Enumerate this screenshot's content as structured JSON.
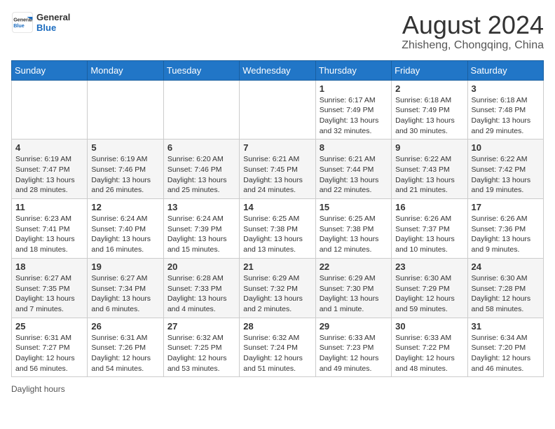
{
  "header": {
    "logo_general": "General",
    "logo_blue": "Blue",
    "main_title": "August 2024",
    "subtitle": "Zhisheng, Chongqing, China"
  },
  "days_of_week": [
    "Sunday",
    "Monday",
    "Tuesday",
    "Wednesday",
    "Thursday",
    "Friday",
    "Saturday"
  ],
  "weeks": [
    [
      {
        "day": "",
        "info": ""
      },
      {
        "day": "",
        "info": ""
      },
      {
        "day": "",
        "info": ""
      },
      {
        "day": "",
        "info": ""
      },
      {
        "day": "1",
        "info": "Sunrise: 6:17 AM\nSunset: 7:49 PM\nDaylight: 13 hours and 32 minutes."
      },
      {
        "day": "2",
        "info": "Sunrise: 6:18 AM\nSunset: 7:49 PM\nDaylight: 13 hours and 30 minutes."
      },
      {
        "day": "3",
        "info": "Sunrise: 6:18 AM\nSunset: 7:48 PM\nDaylight: 13 hours and 29 minutes."
      }
    ],
    [
      {
        "day": "4",
        "info": "Sunrise: 6:19 AM\nSunset: 7:47 PM\nDaylight: 13 hours and 28 minutes."
      },
      {
        "day": "5",
        "info": "Sunrise: 6:19 AM\nSunset: 7:46 PM\nDaylight: 13 hours and 26 minutes."
      },
      {
        "day": "6",
        "info": "Sunrise: 6:20 AM\nSunset: 7:46 PM\nDaylight: 13 hours and 25 minutes."
      },
      {
        "day": "7",
        "info": "Sunrise: 6:21 AM\nSunset: 7:45 PM\nDaylight: 13 hours and 24 minutes."
      },
      {
        "day": "8",
        "info": "Sunrise: 6:21 AM\nSunset: 7:44 PM\nDaylight: 13 hours and 22 minutes."
      },
      {
        "day": "9",
        "info": "Sunrise: 6:22 AM\nSunset: 7:43 PM\nDaylight: 13 hours and 21 minutes."
      },
      {
        "day": "10",
        "info": "Sunrise: 6:22 AM\nSunset: 7:42 PM\nDaylight: 13 hours and 19 minutes."
      }
    ],
    [
      {
        "day": "11",
        "info": "Sunrise: 6:23 AM\nSunset: 7:41 PM\nDaylight: 13 hours and 18 minutes."
      },
      {
        "day": "12",
        "info": "Sunrise: 6:24 AM\nSunset: 7:40 PM\nDaylight: 13 hours and 16 minutes."
      },
      {
        "day": "13",
        "info": "Sunrise: 6:24 AM\nSunset: 7:39 PM\nDaylight: 13 hours and 15 minutes."
      },
      {
        "day": "14",
        "info": "Sunrise: 6:25 AM\nSunset: 7:38 PM\nDaylight: 13 hours and 13 minutes."
      },
      {
        "day": "15",
        "info": "Sunrise: 6:25 AM\nSunset: 7:38 PM\nDaylight: 13 hours and 12 minutes."
      },
      {
        "day": "16",
        "info": "Sunrise: 6:26 AM\nSunset: 7:37 PM\nDaylight: 13 hours and 10 minutes."
      },
      {
        "day": "17",
        "info": "Sunrise: 6:26 AM\nSunset: 7:36 PM\nDaylight: 13 hours and 9 minutes."
      }
    ],
    [
      {
        "day": "18",
        "info": "Sunrise: 6:27 AM\nSunset: 7:35 PM\nDaylight: 13 hours and 7 minutes."
      },
      {
        "day": "19",
        "info": "Sunrise: 6:27 AM\nSunset: 7:34 PM\nDaylight: 13 hours and 6 minutes."
      },
      {
        "day": "20",
        "info": "Sunrise: 6:28 AM\nSunset: 7:33 PM\nDaylight: 13 hours and 4 minutes."
      },
      {
        "day": "21",
        "info": "Sunrise: 6:29 AM\nSunset: 7:32 PM\nDaylight: 13 hours and 2 minutes."
      },
      {
        "day": "22",
        "info": "Sunrise: 6:29 AM\nSunset: 7:30 PM\nDaylight: 13 hours and 1 minute."
      },
      {
        "day": "23",
        "info": "Sunrise: 6:30 AM\nSunset: 7:29 PM\nDaylight: 12 hours and 59 minutes."
      },
      {
        "day": "24",
        "info": "Sunrise: 6:30 AM\nSunset: 7:28 PM\nDaylight: 12 hours and 58 minutes."
      }
    ],
    [
      {
        "day": "25",
        "info": "Sunrise: 6:31 AM\nSunset: 7:27 PM\nDaylight: 12 hours and 56 minutes."
      },
      {
        "day": "26",
        "info": "Sunrise: 6:31 AM\nSunset: 7:26 PM\nDaylight: 12 hours and 54 minutes."
      },
      {
        "day": "27",
        "info": "Sunrise: 6:32 AM\nSunset: 7:25 PM\nDaylight: 12 hours and 53 minutes."
      },
      {
        "day": "28",
        "info": "Sunrise: 6:32 AM\nSunset: 7:24 PM\nDaylight: 12 hours and 51 minutes."
      },
      {
        "day": "29",
        "info": "Sunrise: 6:33 AM\nSunset: 7:23 PM\nDaylight: 12 hours and 49 minutes."
      },
      {
        "day": "30",
        "info": "Sunrise: 6:33 AM\nSunset: 7:22 PM\nDaylight: 12 hours and 48 minutes."
      },
      {
        "day": "31",
        "info": "Sunrise: 6:34 AM\nSunset: 7:20 PM\nDaylight: 12 hours and 46 minutes."
      }
    ]
  ],
  "footer": {
    "daylight_label": "Daylight hours"
  }
}
